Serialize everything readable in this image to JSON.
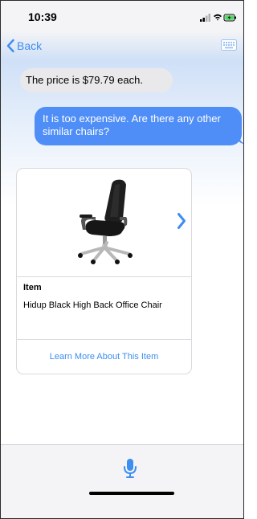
{
  "status_bar": {
    "time": "10:39",
    "icons": [
      "signal-icon",
      "wifi-icon",
      "battery-charging-icon"
    ]
  },
  "nav": {
    "back_label": "Back",
    "right_icon": "keyboard-icon"
  },
  "messages": [
    {
      "from": "assistant",
      "text": "The price is $79.79 each."
    },
    {
      "from": "user",
      "text": "It is too expensive. Are there any other similar chairs?"
    }
  ],
  "card": {
    "image_icon": "office-chair-image",
    "kind_label": "Item",
    "title": "Hidup Black High Back Office Chair",
    "link_label": "Learn More About This Item",
    "next_icon": "chevron-right-icon"
  },
  "input_bar": {
    "mic_icon": "microphone-icon"
  },
  "colors": {
    "accent": "#3d8ef0",
    "outgoing_bubble": "#4f8ef7",
    "incoming_bubble": "#e9e9eb"
  }
}
